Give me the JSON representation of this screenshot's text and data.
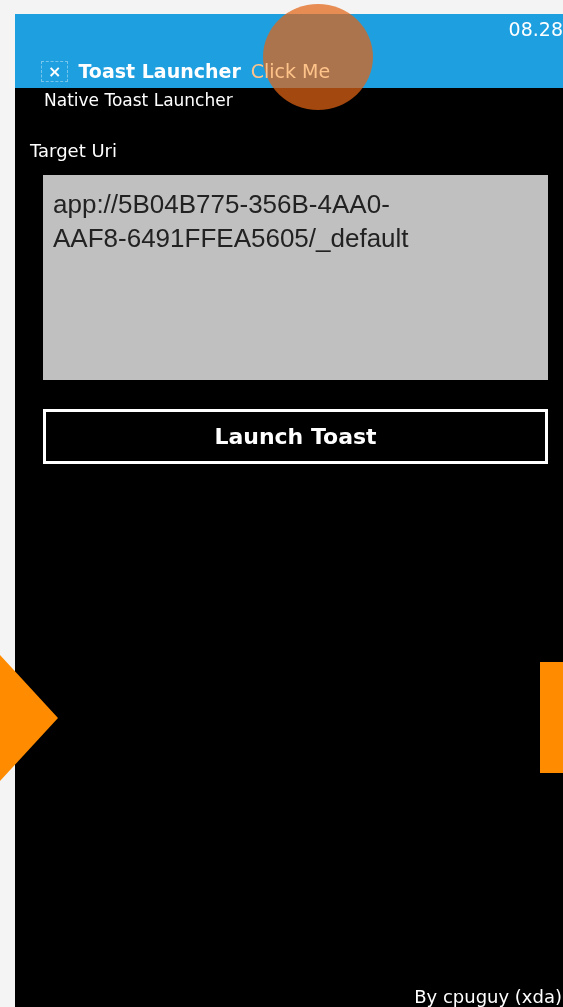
{
  "status_bar": {
    "time": "08.28"
  },
  "toast": {
    "close": "×",
    "title": "Toast Launcher",
    "action": "Click Me"
  },
  "app_title": "Native Toast Launcher",
  "target_uri": {
    "label": "Target Uri",
    "value": "app://5B04B775-356B-4AA0-AAF8-6491FFEA5605/_default"
  },
  "launch_button": "Launch Toast",
  "footer": "By cpuguy (xda)"
}
